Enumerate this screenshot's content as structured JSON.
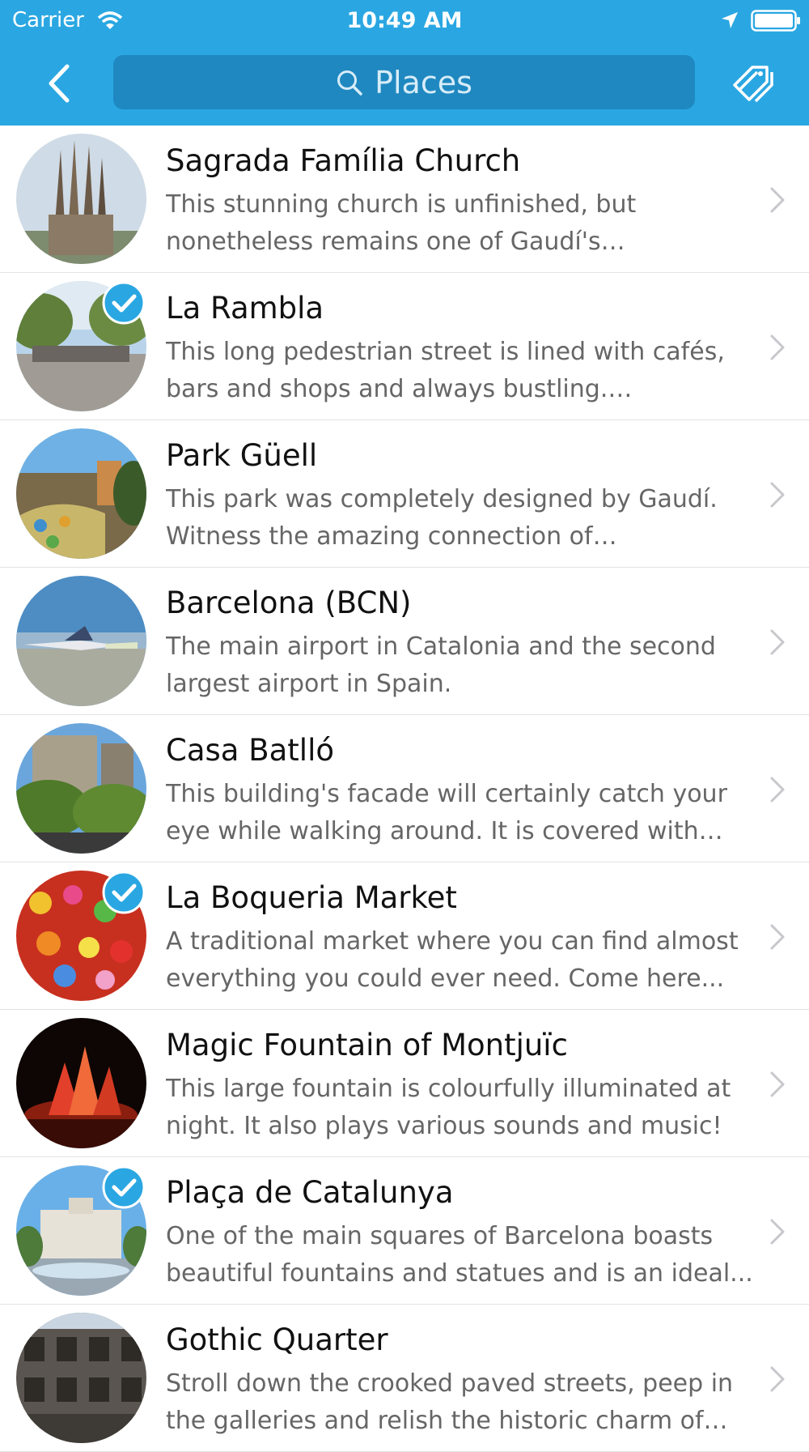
{
  "status": {
    "carrier": "Carrier",
    "time": "10:49 AM"
  },
  "nav": {
    "search_label": "Places"
  },
  "colors": {
    "header": "#2aa7e2",
    "search_field": "#1f88c0",
    "check": "#2aa7e2"
  },
  "places": [
    {
      "title": "Sagrada Família Church",
      "description": "This stunning church is unfinished, but nonetheless remains one of Gaudí's masterpieces...",
      "checked": false
    },
    {
      "title": "La Rambla",
      "description": "This long pedestrian street is lined with cafés, bars and shops and always bustling. Performers...",
      "checked": true
    },
    {
      "title": "Park Güell",
      "description": "This park was completely designed by Gaudí. Witness the amazing connection of architecture...",
      "checked": false
    },
    {
      "title": "Barcelona (BCN)",
      "description": "The main airport in Catalonia and the second largest airport in Spain.",
      "checked": false
    },
    {
      "title": "Casa Batlló",
      "description": "This building's facade will certainly catch your eye while walking around. It is covered with colorful...",
      "checked": false
    },
    {
      "title": "La Boqueria Market",
      "description": "A traditional market where you can find almost everything you could ever need. Come here...",
      "checked": true
    },
    {
      "title": "Magic Fountain of Montjuïc",
      "description": "This large fountain is colourfully illuminated at night. It also plays various sounds and music!",
      "checked": false
    },
    {
      "title": "Plaça de Catalunya",
      "description": "One of the main squares of Barcelona boasts beautiful fountains and statues and is an ideal...",
      "checked": true
    },
    {
      "title": "Gothic Quarter",
      "description": "Stroll down the crooked paved streets, peep in the galleries and relish the historic charm of the...",
      "checked": false
    }
  ]
}
